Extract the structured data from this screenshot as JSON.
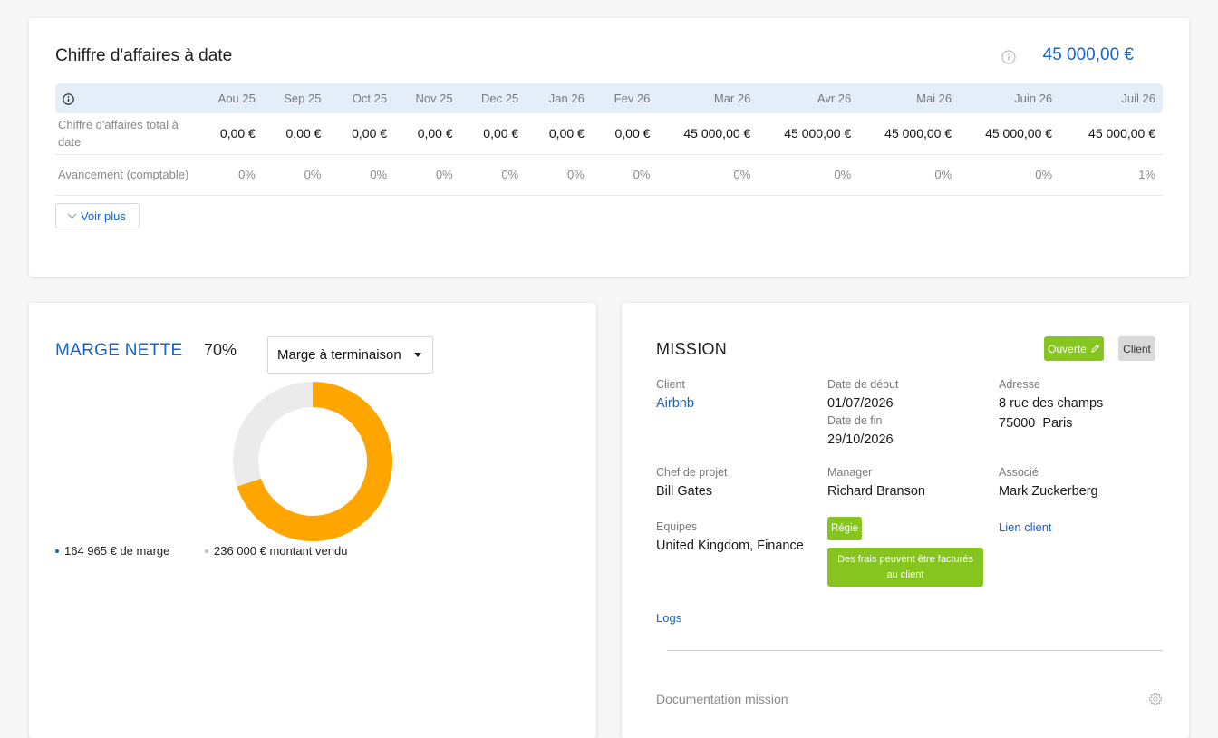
{
  "revenue": {
    "title": "Chiffre d'affaires à date",
    "total": "45 000,00 €",
    "months": [
      "Aou 25",
      "Sep 25",
      "Oct 25",
      "Nov 25",
      "Dec 25",
      "Jan 26",
      "Fev 26",
      "Mar 26",
      "Avr 26",
      "Mai 26",
      "Juin 26",
      "Juil 26"
    ],
    "rows": [
      {
        "label": "Chiffre d'affaires total à date",
        "values": [
          "0,00 €",
          "0,00 €",
          "0,00 €",
          "0,00 €",
          "0,00 €",
          "0,00 €",
          "0,00 €",
          "45 000,00 €",
          "45 000,00 €",
          "45 000,00 €",
          "45 000,00 €",
          "45 000,00 €"
        ]
      },
      {
        "label": "Avancement (comptable)",
        "values": [
          "0%",
          "0%",
          "0%",
          "0%",
          "0%",
          "0%",
          "0%",
          "0%",
          "0%",
          "0%",
          "0%",
          "1%"
        ]
      }
    ],
    "more_button": "Voir plus"
  },
  "margin": {
    "title": "MARGE NETTE",
    "percent": "70%",
    "selector": "Marge à terminaison",
    "donut": {
      "margin_value": 164965,
      "sold_value": 236000
    },
    "legend_margin": "164 965 € de marge",
    "legend_sold": "236 000 € montant vendu",
    "colors": {
      "margin": "#ffa500",
      "rest": "#ebebeb",
      "margin_dot": "#1663c7",
      "sold_dot": "#bdbdbd"
    }
  },
  "mission": {
    "title": "MISSION",
    "status_badge": "Ouverte",
    "type_badge": "Client",
    "client_label": "Client",
    "client_value": "Airbnb",
    "start_label": "Date de début",
    "start_value": "01/07/2026",
    "end_label": "Date de fin",
    "end_value": "29/10/2026",
    "address_label": "Adresse",
    "address_line1": "8 rue des champs",
    "address_line2": "75000  Paris",
    "pm_label": "Chef de projet",
    "pm_value": "Bill Gates",
    "manager_label": "Manager",
    "manager_value": "Richard Branson",
    "associate_label": "Associé",
    "associate_value": "Mark Zuckerberg",
    "teams_label": "Equipes",
    "teams_value": "United Kingdom, Finance",
    "regie_badge": "Régie",
    "fees_badge": "Des frais peuvent être facturés au client",
    "client_link": "Lien client",
    "logs_link": "Logs",
    "documentation_label": "Documentation mission"
  }
}
